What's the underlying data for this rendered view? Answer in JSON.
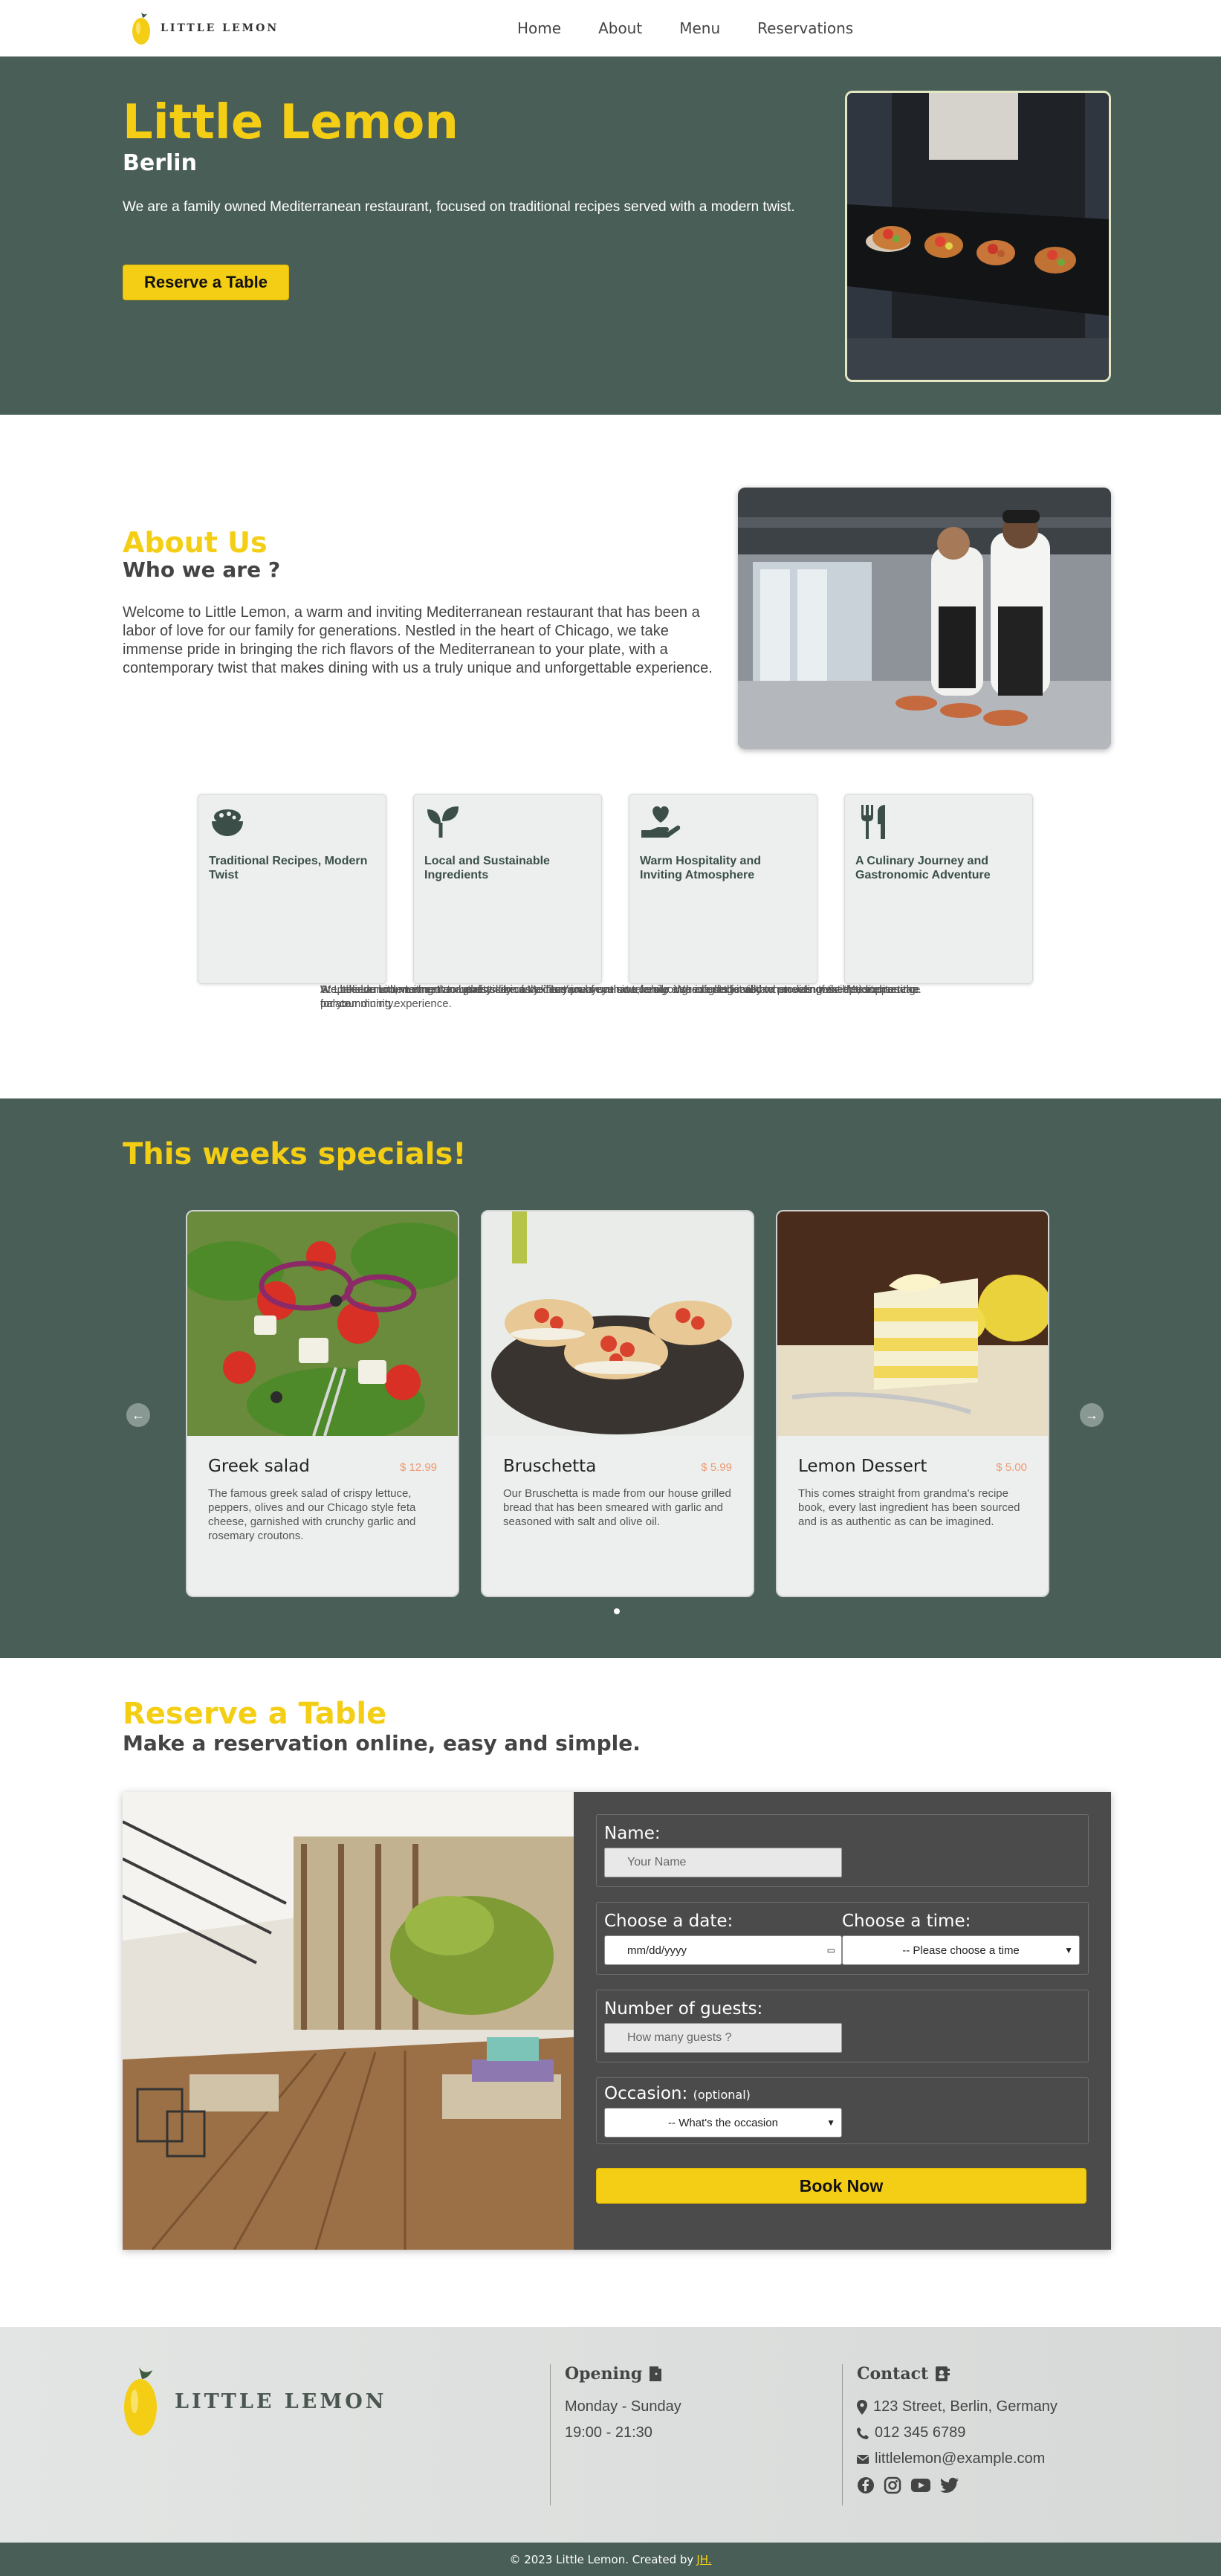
{
  "brand": {
    "name": "LITTLE LEMON"
  },
  "nav": {
    "items": [
      "Home",
      "About",
      "Menu",
      "Reservations"
    ]
  },
  "hero": {
    "title": "Little Lemon",
    "subtitle": "Berlin",
    "description": "We are a family owned Mediterranean restaurant, focused on traditional recipes served with a modern twist.",
    "cta": "Reserve a Table"
  },
  "about": {
    "title": "About Us",
    "subtitle": "Who we are ?",
    "text": "Welcome to Little Lemon, a warm and inviting Mediterranean restaurant that has been a labor of love for our family for generations. Nestled in the heart of Chicago, we take immense pride in bringing the rich flavors of the Mediterranean to your plate, with a contemporary twist that makes dining with us a truly unique and unforgettable experience.",
    "features": [
      {
        "icon": "bowl-icon",
        "title": "Traditional Recipes, Modern Twist",
        "text": "We believe in honoring the authenticity of Mediterranean cuisine, while also infusing it with a modern twist that excites the palate."
      },
      {
        "icon": "seedling-icon",
        "title": "Local and Sustainable Ingredients",
        "text": "We take our commitment to quality seriously. That's why we source our ingredients locally whenever possible, supporting our community."
      },
      {
        "icon": "hand-heart-icon",
        "title": "Warm Hospitality and Inviting Atmosphere",
        "text": "At Little Lemon, we treat our guests like an extension of our own family. We are dedicated to providing exceptional service for your dining experience."
      },
      {
        "icon": "utensils-icon",
        "title": "A Culinary Journey and Gastronomic Adventure",
        "text": "Step inside Little Lemon and embark on a culinary journey that takes you through the vibrant streets of the Mediterranean."
      }
    ]
  },
  "specials": {
    "title": "This weeks specials!",
    "items": [
      {
        "name": "Greek salad",
        "price": "$ 12.99",
        "text": "The famous greek salad of crispy lettuce, peppers, olives and our Chicago style feta cheese, garnished with crunchy garlic and rosemary croutons."
      },
      {
        "name": "Bruschetta",
        "price": "$ 5.99",
        "text": "Our Bruschetta is made from our house grilled bread that has been smeared with garlic and seasoned with salt and olive oil."
      },
      {
        "name": "Lemon Dessert",
        "price": "$ 5.00",
        "text": "This comes straight from grandma's recipe book, every last ingredient has been sourced and is as authentic as can be imagined."
      }
    ],
    "prev": "←",
    "next": "→"
  },
  "reserve": {
    "title": "Reserve a Table",
    "subtitle": "Make a reservation online, easy and simple.",
    "name_label": "Name:",
    "name_placeholder": "Your Name",
    "date_label": "Choose a date:",
    "date_value": "mm/dd/yyyy",
    "time_label": "Choose a time:",
    "time_value": "-- Please choose a time",
    "guests_label": "Number of guests:",
    "guests_placeholder": "How many guests ?",
    "occasion_label": "Occasion:",
    "occasion_optional": "(optional)",
    "occasion_value": "-- What's the occasion",
    "submit": "Book Now"
  },
  "footer": {
    "opening_title": "Opening",
    "opening_days": "Monday - Sunday",
    "opening_hours": "19:00 - 21:30",
    "contact_title": "Contact",
    "address": "123 Street, Berlin, Germany",
    "phone": "012 345 6789",
    "email": "littlelemon@example.com",
    "socials": [
      "facebook-icon",
      "instagram-icon",
      "youtube-icon",
      "twitter-icon"
    ],
    "copyright": "© 2023 Little Lemon. Created by",
    "author": "JH."
  },
  "colors": {
    "primary": "#495e57",
    "accent": "#f4ce14",
    "price": "#ee9972"
  }
}
